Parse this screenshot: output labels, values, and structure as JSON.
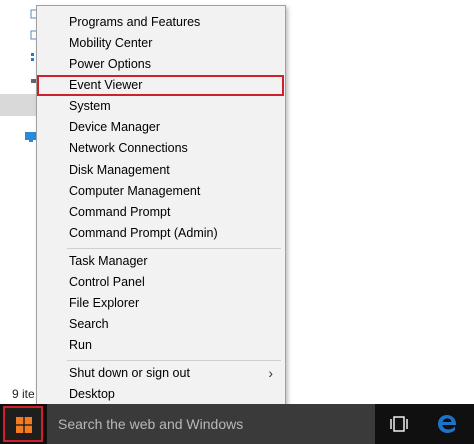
{
  "menu": {
    "items": [
      {
        "label": "Programs and Features"
      },
      {
        "label": "Mobility Center"
      },
      {
        "label": "Power Options"
      },
      {
        "label": "Event Viewer"
      },
      {
        "label": "System"
      },
      {
        "label": "Device Manager"
      },
      {
        "label": "Network Connections"
      },
      {
        "label": "Disk Management"
      },
      {
        "label": "Computer Management"
      },
      {
        "label": "Command Prompt"
      },
      {
        "label": "Command Prompt (Admin)"
      },
      {
        "label": "Task Manager"
      },
      {
        "label": "Control Panel"
      },
      {
        "label": "File Explorer"
      },
      {
        "label": "Search"
      },
      {
        "label": "Run"
      },
      {
        "label": "Shut down or sign out"
      },
      {
        "label": "Desktop"
      }
    ],
    "highlighted_item": "Event Viewer",
    "submenu_arrow": "›"
  },
  "explorer": {
    "status_text": "9 ite"
  },
  "taskbar": {
    "search_placeholder": "Search the web and Windows",
    "start_icon": "windows-logo-icon",
    "taskview_icon": "task-view-icon",
    "browser_icon": "edge-icon"
  },
  "colors": {
    "highlight_border": "#d0202e",
    "taskbar_bg": "#101010",
    "search_bg": "#3a3a3a",
    "menu_bg": "#f2f2f2",
    "windows_logo": "#f47b20",
    "edge_blue": "#1e73c8"
  }
}
